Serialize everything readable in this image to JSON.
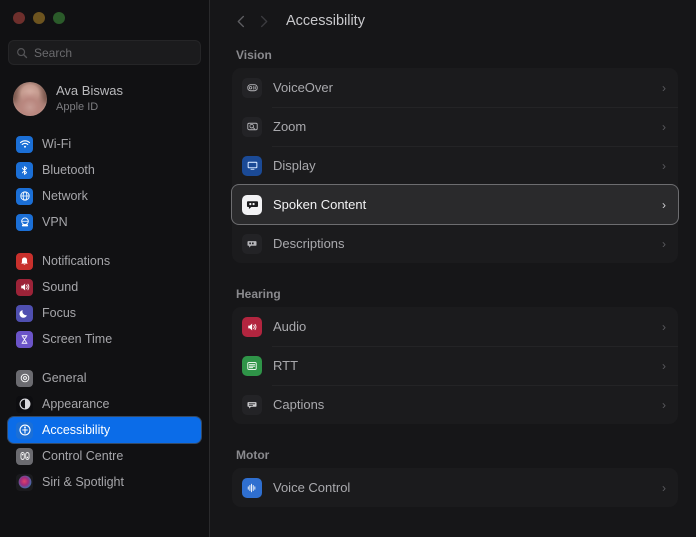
{
  "window": {
    "traffic_lights": [
      {
        "name": "close-button",
        "color": "#6e2f2c"
      },
      {
        "name": "minimize-button",
        "color": "#6d541f"
      },
      {
        "name": "maximize-button",
        "color": "#2b5b2a"
      }
    ]
  },
  "search": {
    "placeholder": "Search",
    "value": "",
    "icon": "search-icon"
  },
  "profile": {
    "name": "Ava Biswas",
    "subtitle": "Apple ID",
    "icon": "avatar"
  },
  "sidebar": {
    "groups": [
      {
        "items": [
          {
            "label": "Wi-Fi",
            "icon": "wifi-icon",
            "color": "#1b6fd6",
            "selected": false
          },
          {
            "label": "Bluetooth",
            "icon": "bluetooth-icon",
            "color": "#1b6fd6",
            "selected": false
          },
          {
            "label": "Network",
            "icon": "network-globe-icon",
            "color": "#1b6fd6",
            "selected": false
          },
          {
            "label": "VPN",
            "icon": "vpn-icon",
            "color": "#1b6fd6",
            "selected": false
          }
        ]
      },
      {
        "items": [
          {
            "label": "Notifications",
            "icon": "bell-icon",
            "color": "#c8302c",
            "selected": false
          },
          {
            "label": "Sound",
            "icon": "speaker-icon",
            "color": "#9c2338",
            "selected": false
          },
          {
            "label": "Focus",
            "icon": "moon-icon",
            "color": "#4f4fb0",
            "selected": false
          },
          {
            "label": "Screen Time",
            "icon": "hourglass-icon",
            "color": "#6b54c8",
            "selected": false
          }
        ]
      },
      {
        "items": [
          {
            "label": "General",
            "icon": "gear-icon",
            "color": "#6b6b70",
            "selected": false
          },
          {
            "label": "Appearance",
            "icon": "appearance-contrast-icon",
            "color": "#17171a",
            "selected": false
          },
          {
            "label": "Accessibility",
            "icon": "accessibility-icon",
            "color": "#1b6fd6",
            "selected": true
          },
          {
            "label": "Control Centre",
            "icon": "control-centre-icon",
            "color": "#6b6b70",
            "selected": false
          },
          {
            "label": "Siri & Spotlight",
            "icon": "siri-icon",
            "color": "#3b2f4d",
            "selected": false
          }
        ]
      }
    ]
  },
  "toolbar": {
    "back_label": "‹",
    "forward_label": "›",
    "title": "Accessibility"
  },
  "main": {
    "sections": [
      {
        "header": "Vision",
        "rows": [
          {
            "label": "VoiceOver",
            "icon": "voiceover-icon",
            "color": "#232326",
            "focused": false,
            "chevron": "›"
          },
          {
            "label": "Zoom",
            "icon": "zoom-magnifier-icon",
            "color": "#232326",
            "focused": false,
            "chevron": "›"
          },
          {
            "label": "Display",
            "icon": "display-monitor-icon",
            "color": "#1b4a96",
            "focused": false,
            "chevron": "›"
          },
          {
            "label": "Spoken Content",
            "icon": "spoken-content-icon",
            "color": "#f2f2f4",
            "focused": true,
            "chevron": "›"
          },
          {
            "label": "Descriptions",
            "icon": "descriptions-icon",
            "color": "#232326",
            "focused": false,
            "chevron": "›"
          }
        ]
      },
      {
        "header": "Hearing",
        "rows": [
          {
            "label": "Audio",
            "icon": "audio-speaker-icon",
            "color": "#b2253f",
            "focused": false,
            "chevron": "›"
          },
          {
            "label": "RTT",
            "icon": "rtt-icon",
            "color": "#2f9448",
            "focused": false,
            "chevron": "›"
          },
          {
            "label": "Captions",
            "icon": "captions-icon",
            "color": "#232326",
            "focused": false,
            "chevron": "›"
          }
        ]
      },
      {
        "header": "Motor",
        "rows": [
          {
            "label": "Voice Control",
            "icon": "voice-control-icon",
            "color": "#2f6fd0",
            "focused": false,
            "chevron": "›"
          }
        ]
      }
    ]
  }
}
